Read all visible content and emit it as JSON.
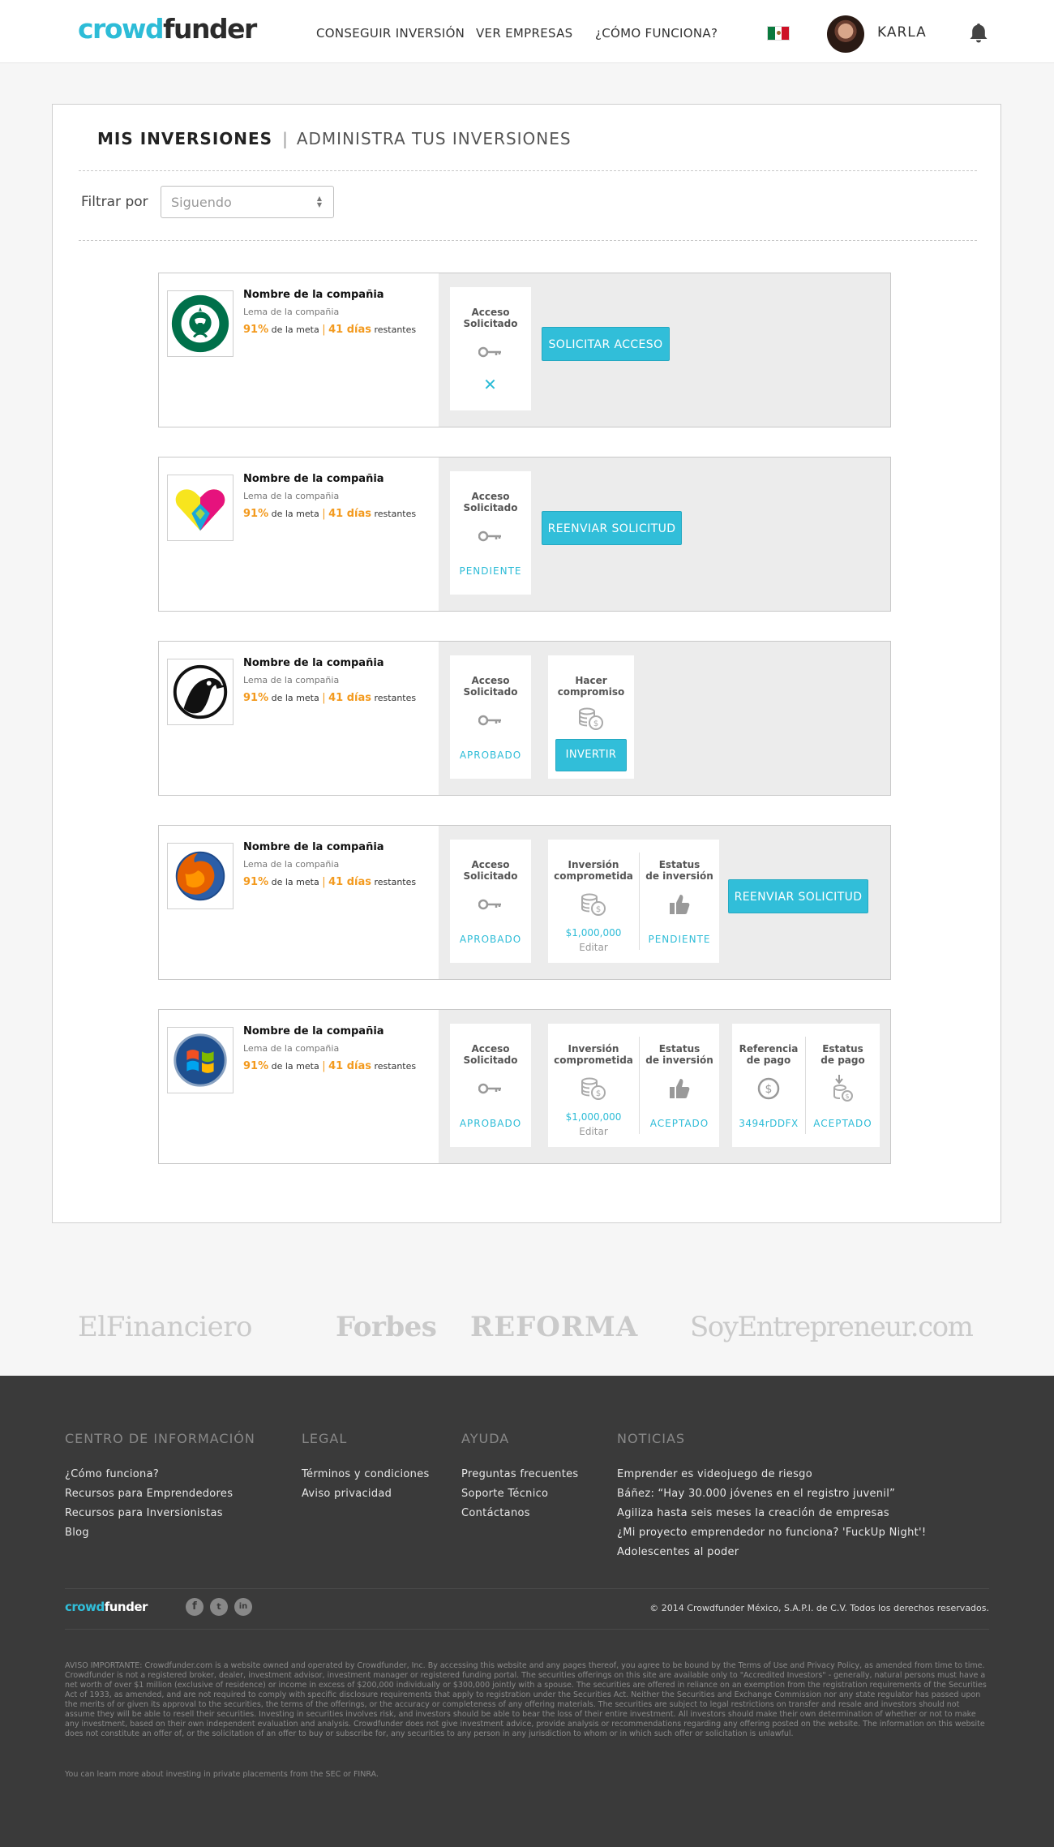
{
  "header": {
    "logo_a": "crowd",
    "logo_b": "funder",
    "nav": [
      "CONSEGUIR INVERSIÓN",
      "VER EMPRESAS",
      "¿CÓMO FUNCIONA?"
    ],
    "user_name": "KARLA"
  },
  "page": {
    "title": "MIS INVERSIONES",
    "separator": "|",
    "subtitle": "ADMINISTRA TUS INVERSIONES",
    "filter_label": "Filtrar por",
    "filter_value": "Siguendo"
  },
  "company": {
    "name": "Nombre de la compañia",
    "slogan": "Lema de la compañia",
    "percent": "91%",
    "of_goal": "de la meta",
    "bar": "|",
    "days": "41 días",
    "remaining": "restantes"
  },
  "labels": {
    "access_1": "Acceso",
    "access_2": "Solicitado",
    "commit_1": "Hacer",
    "commit_2": "compromiso",
    "inv_1": "Inversión",
    "inv_2": "comprometida",
    "status_1": "Estatus",
    "status_2": "de inversión",
    "ref_1": "Referencia",
    "ref_2": "de pago",
    "paystat_1": "Estatus",
    "paystat_2": "de pago",
    "amount": "$1,000,000",
    "edit": "Editar",
    "ref_code": "3494rDDFX"
  },
  "statuses": {
    "pending": "PENDIENTE",
    "approved": "APROBADO",
    "accepted": "ACEPTADO",
    "rejected_mark": "✕"
  },
  "buttons": {
    "request_access": "SOLICITAR ACCESO",
    "resend": "REENVIAR SOLICITUD",
    "invest": "INVERTIR"
  },
  "press": [
    "ElFinanciero",
    "Forbes",
    "REFORMA",
    "SoyEntrepreneur.com"
  ],
  "footer": {
    "col1_title": "CENTRO DE INFORMACIÓN",
    "col1": [
      "¿Cómo funciona?",
      "Recursos para Emprendedores",
      "Recursos para Inversionistas",
      "Blog"
    ],
    "col2_title": "LEGAL",
    "col2": [
      "Términos y condiciones",
      "Aviso privacidad"
    ],
    "col3_title": "AYUDA",
    "col3": [
      "Preguntas frecuentes",
      "Soporte Técnico",
      "Contáctanos"
    ],
    "col4_title": "NOTICIAS",
    "col4": [
      "Emprender es videojuego de riesgo",
      "Báñez: “Hay 30.000 jóvenes en el registro juvenil”",
      "Agiliza hasta seis meses la creación de empresas",
      "¿Mi proyecto emprendedor no funciona? 'FuckUp Night'!",
      "Adolescentes al poder"
    ],
    "logo_a": "crowd",
    "logo_b": "funder",
    "social": [
      "f",
      "t",
      "in"
    ],
    "copyright": "© 2014 Crowdfunder México, S.A.P.I. de C.V. Todos los derechos reservados.",
    "legal": "AVISO IMPORTANTE: Crowdfunder.com is a website owned and operated by Crowdfunder, Inc. By accessing this website and any pages thereof, you agree to be bound by the Terms of Use and Privacy Policy, as amended from time to time. Crowdfunder is not a registered broker, dealer, investment advisor, investment manager or registered funding portal. The securities offerings on this site are available only to \"Accredited Investors\" - generally, natural persons must have a net worth of over $1 million (exclusive of residence) or income in excess of $200,000 individually or $300,000 jointly with a spouse. The securities are offered in reliance on an exemption from the registration requirements of the Securities Act of 1933, as amended, and are not required to comply with specific disclosure requirements that apply to registration under the Securities Act. Neither the Securities and Exchange Commission nor any state regulator has passed upon the merits of or given its approval to the securities, the terms of the offerings, or the accuracy or completeness of any offering materials. The securities are subject to legal restrictions on transfer and resale and investors should not assume they will be able to resell their securities. Investing in securities involves risk, and investors should be able to bear the loss of their entire investment. All investors should make their own determination of whether or not to make any investment, based on their own independent evaluation and analysis. Crowdfunder does not give investment advice, provide analysis or recommendations regarding any offering posted on the website. The information on this website does not constitute an offer of, or the solicitation of an offer to buy or subscribe for, any securities to any person in any jurisdiction to whom or in which such offer or solicitation is unlawful.",
    "learn": "You can learn more about investing in private placements from the SEC or FINRA."
  },
  "colors": {
    "accent": "#31bed9",
    "orange": "#f39a1e",
    "footer_bg": "#3a3a3a"
  }
}
